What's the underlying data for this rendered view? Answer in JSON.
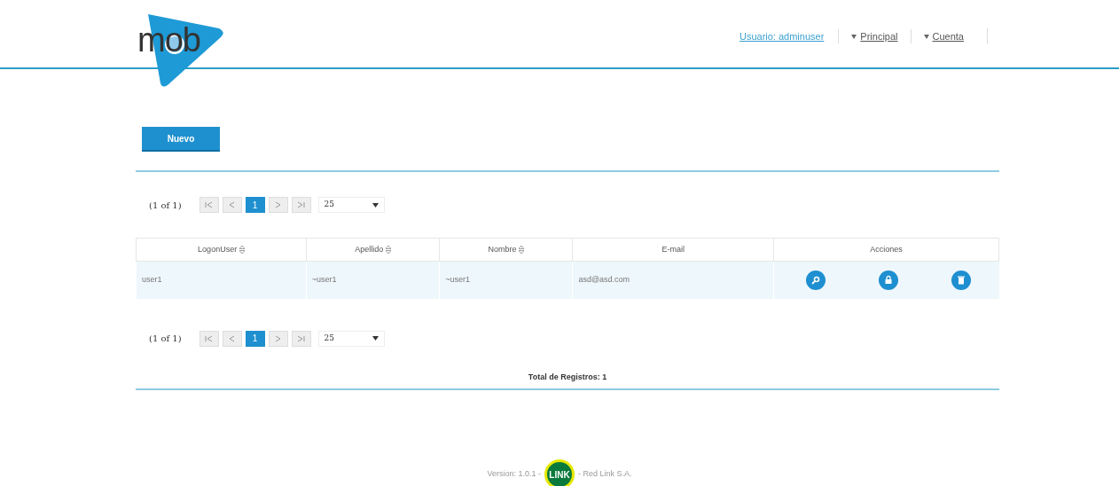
{
  "header": {
    "logo": "mob",
    "user": "Usuario: adminuser",
    "menus": [
      {
        "label": "Principal"
      },
      {
        "label": "Cuenta"
      }
    ]
  },
  "new_button": "Nuevo",
  "pagers": [
    {
      "info": "(1 of 1)",
      "buttons": [
        {
          "kind": "first"
        },
        {
          "kind": "prev"
        },
        {
          "kind": "page",
          "label": "1",
          "selected": true
        },
        {
          "kind": "next"
        },
        {
          "kind": "last"
        }
      ],
      "page_size": "25"
    },
    {
      "info": "(1 of 1)",
      "buttons": [
        {
          "kind": "first"
        },
        {
          "kind": "prev"
        },
        {
          "kind": "page",
          "label": "1",
          "selected": true
        },
        {
          "kind": "next"
        },
        {
          "kind": "last"
        }
      ],
      "page_size": "25"
    }
  ],
  "table": {
    "columns": [
      {
        "label": "LogonUser",
        "sortable": true
      },
      {
        "label": "Apellido",
        "sortable": true
      },
      {
        "label": "Nombre",
        "sortable": true
      },
      {
        "label": "E-mail",
        "sortable": false
      },
      {
        "label": "Acciones",
        "sortable": false
      }
    ],
    "rows": [
      {
        "cells": [
          "user1",
          "~user1",
          "~user1",
          "asd@asd.com"
        ],
        "actions": [
          {
            "kind": "key"
          },
          {
            "kind": "lock"
          },
          {
            "kind": "trash"
          }
        ]
      }
    ]
  },
  "total": "Total de Registros: 1",
  "footer": {
    "version": "Version: 1.0.1 -",
    "logo": "LINK",
    "company": "- Red Link S.A."
  }
}
